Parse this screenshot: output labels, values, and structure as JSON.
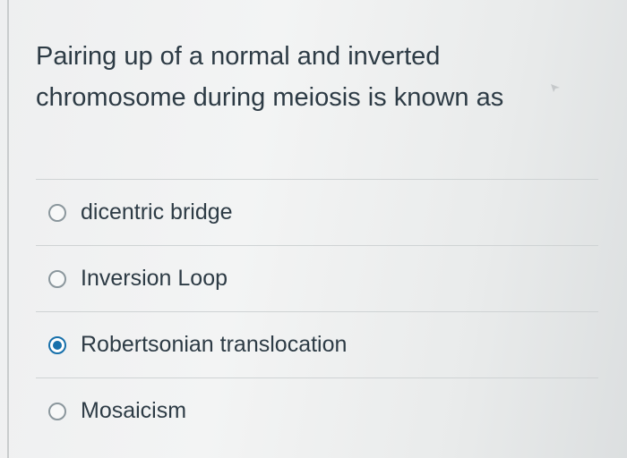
{
  "question": {
    "line1": "Pairing up of a normal and inverted",
    "line2": "chromosome during meiosis is known as"
  },
  "answers": [
    {
      "label": "dicentric bridge",
      "selected": false
    },
    {
      "label": "Inversion Loop",
      "selected": false
    },
    {
      "label": "Robertsonian translocation",
      "selected": true
    },
    {
      "label": "Mosaicism",
      "selected": false
    }
  ],
  "colors": {
    "text": "#2d3b45",
    "accent": "#1770ab",
    "radio_border": "#8b979d",
    "divider": "#cfd3d4"
  },
  "icons": {
    "pointer": "cursor-pointer-icon"
  }
}
